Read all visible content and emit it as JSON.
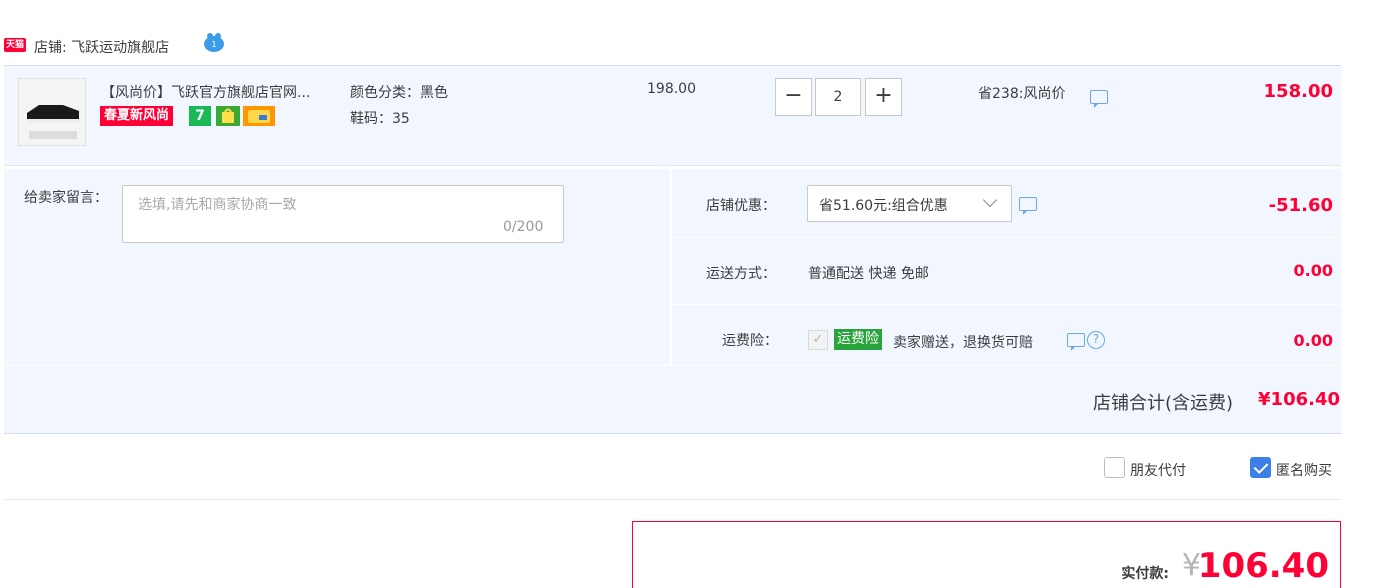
{
  "store": {
    "platform_badge": "天猫",
    "label": "店铺: 飞跃运动旗舰店"
  },
  "item": {
    "title": "【风尚价】飞跃官方旗舰店官网...",
    "promo_tag": "春夏新风尚",
    "tag_7": "7",
    "sku_color": "颜色分类：黑色",
    "sku_size": "鞋码：35",
    "unit_price": "198.00",
    "quantity": "2",
    "qty_minus": "−",
    "qty_plus": "+",
    "discount_note": "省238:风尚价",
    "total": "158.00"
  },
  "remark": {
    "label": "给卖家留言：",
    "placeholder": "选填,请先和商家协商一致",
    "count": "0/200"
  },
  "shop_discount": {
    "label": "店铺优惠：",
    "selected": "省51.60元:组合优惠",
    "value": "-51.60"
  },
  "shipping": {
    "label": "运送方式：",
    "method": "普通配送 快递 免邮",
    "fee": "0.00"
  },
  "insurance": {
    "label": "运费险：",
    "badge": "运费险",
    "description": "卖家赠送，退换货可赔",
    "fee": "0.00",
    "help": "?"
  },
  "subtotal": {
    "label": "店铺合计(含运费)",
    "value": "¥106.40"
  },
  "options": {
    "friend_pay": "朋友代付",
    "anonymous": "匿名购买"
  },
  "payment": {
    "label": "实付款:",
    "currency": "¥",
    "amount": "106.40"
  },
  "colors": {
    "accent_red": "#ff0036",
    "row_bg": "#f2f7ff",
    "checkbox_blue": "#3c7fe8",
    "insurance_green": "#29a33b"
  }
}
